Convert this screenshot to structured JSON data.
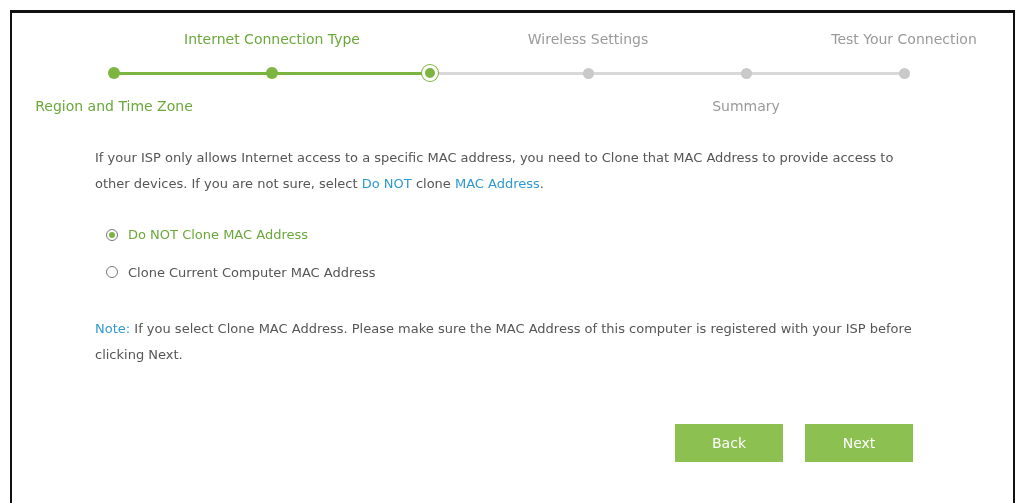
{
  "steps": [
    {
      "label_below": "Region and Time Zone",
      "completed": true,
      "selected": false
    },
    {
      "label_above": "Internet Connection Type",
      "completed": true,
      "selected": false
    },
    {
      "completed": true,
      "selected": true
    },
    {
      "label_above": "Wireless Settings",
      "completed": false,
      "selected": false
    },
    {
      "label_below": "Summary",
      "completed": false,
      "selected": false
    },
    {
      "label_above": "Test Your Connection",
      "completed": false,
      "selected": false
    }
  ],
  "intro": [
    {
      "kind": "text",
      "text": "If your ISP only allows Internet access to a specific MAC address, you need to Clone that MAC Address to provide access to other devices. If you are not sure, select"
    },
    {
      "kind": "link",
      "text": "Do NOT"
    },
    {
      "kind": "text",
      "text": "clone"
    },
    {
      "kind": "link",
      "text": "MAC Address"
    },
    {
      "kind": "text",
      "text": "."
    }
  ],
  "options": [
    {
      "label": "Do NOT Clone MAC Address",
      "selected": true
    },
    {
      "label": "Clone Current Computer MAC Address",
      "selected": false
    }
  ],
  "note": {
    "label": "Note:",
    "text": "If you select Clone MAC Address. Please make sure the MAC Address of this computer is registered with your ISP before clicking Next."
  },
  "buttons": [
    "Back",
    "Next"
  ]
}
